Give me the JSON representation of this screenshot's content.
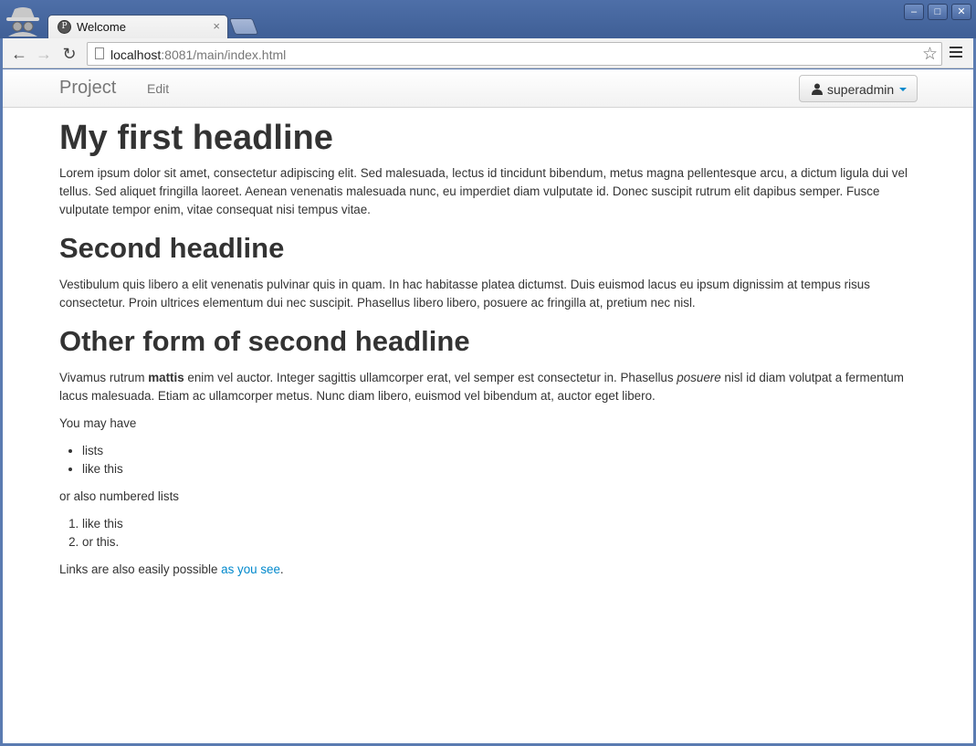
{
  "browser": {
    "tab_title": "Welcome",
    "tab_close": "×",
    "url_host": "localhost",
    "url_rest": ":8081/main/index.html",
    "window_buttons": {
      "minimize": "–",
      "maximize": "□",
      "close": "✕"
    }
  },
  "navbar": {
    "brand": "Project",
    "edit_link": "Edit",
    "user_menu": "superadmin"
  },
  "content": {
    "h1": "My first headline",
    "p1": "Lorem ipsum dolor sit amet, consectetur adipiscing elit. Sed malesuada, lectus id tincidunt bibendum, metus magna pellentesque arcu, a dictum ligula dui vel tellus. Sed aliquet fringilla laoreet. Aenean venenatis malesuada nunc, eu imperdiet diam vulputate id. Donec suscipit rutrum elit dapibus semper. Fusce vulputate tempor enim, vitae consequat nisi tempus vitae.",
    "h2a": "Second headline",
    "p2": "Vestibulum quis libero a elit venenatis pulvinar quis in quam. In hac habitasse platea dictumst. Duis euismod lacus eu ipsum dignissim at tempus risus consectetur. Proin ultrices elementum dui nec suscipit. Phasellus libero libero, posuere ac fringilla at, pretium nec nisl.",
    "h2b": "Other form of second headline",
    "p3_part1": "Vivamus rutrum ",
    "p3_bold": "mattis",
    "p3_part2": " enim vel auctor. Integer sagittis ullamcorper erat, vel semper est consectetur in. Phasellus ",
    "p3_italic": "posuere",
    "p3_part3": " nisl id diam volutpat a fermentum lacus malesuada. Etiam ac ullamcorper metus. Nunc diam libero, euismod vel bibendum at, auctor eget libero.",
    "p4": "You may have",
    "ul": [
      "lists",
      "like this"
    ],
    "p5": "or also numbered lists",
    "ol": [
      "like this",
      "or this."
    ],
    "p6_text": "Links are also easily possible ",
    "p6_link": "as you see",
    "p6_end": "."
  }
}
